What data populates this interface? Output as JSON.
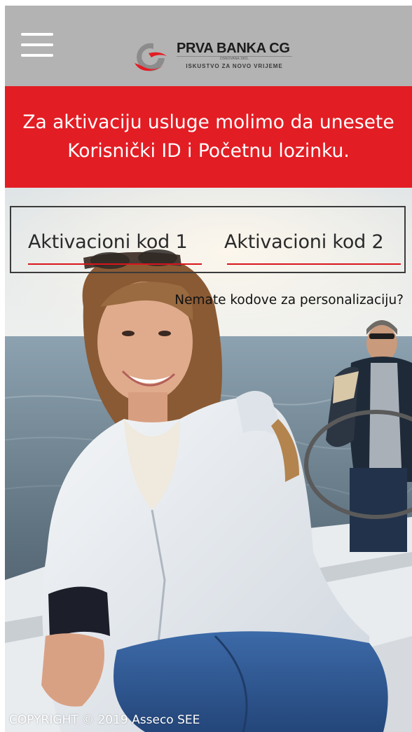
{
  "header": {
    "menu_icon": "hamburger-menu-icon",
    "logo": {
      "name": "PRVA BANKA CG",
      "founded": "OSNOVANA 1901.",
      "tagline": "ISKUSTVO ZA NOVO VRIJEME",
      "mark_colors": {
        "grey": "#8c8c8c",
        "red": "#e31d24"
      }
    },
    "background": "#b3b3b3"
  },
  "banner": {
    "line1": "Za aktivaciju usluge molimo da unesete",
    "line2": "Korisnički ID i Početnu lozinku.",
    "background": "#e31d24"
  },
  "activation": {
    "code1_placeholder": "Aktivacioni kod 1",
    "code2_placeholder": "Aktivacioni kod 2",
    "underline_color": "#d9151c",
    "no_codes_link": "Nemate kodove za personalizaciju?"
  },
  "footer": {
    "copyright": "COPYRIGHT © 2019 Asseco SEE"
  }
}
